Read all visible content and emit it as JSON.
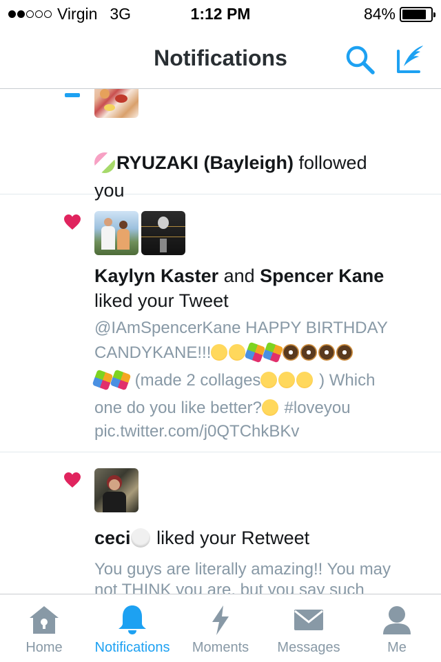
{
  "status_bar": {
    "carrier": "Virgin",
    "network": "3G",
    "time": "1:12 PM",
    "battery": "84%",
    "battery_level": 0.84,
    "signal_bars_filled": 2,
    "signal_bars_total": 5
  },
  "header": {
    "title": "Notifications",
    "search_icon": "search-icon",
    "compose_icon": "compose-tweet-icon"
  },
  "colors": {
    "accent": "#1da1f2",
    "like": "#e0245e",
    "muted": "#8899a6",
    "text": "#14171a"
  },
  "notifications": [
    {
      "type": "follow",
      "icon": "person-icon",
      "name_prefix_emoji": "dango-emoji",
      "name": "RYUZAKI (Bayleigh)",
      "action_line1": " followed",
      "action_line2": "you"
    },
    {
      "type": "like",
      "icon": "heart-icon",
      "user1": "Kaylyn Kaster",
      "joiner": " and ",
      "user2": "Spencer Kane",
      "action": "liked your Tweet",
      "tweet_line1": "@IAmSpencerKane HAPPY BIRTHDAY",
      "tweet_line2": "CANDYKANE!!!",
      "tweet_line3_text": " (made 2 collages",
      "tweet_line3_tail": " Which",
      "tweet_line4": "one do you like better?",
      "tweet_line4_tail": " #loveyou",
      "tweet_line5": "pic.twitter.com/j0QTChkBKv"
    },
    {
      "type": "like",
      "icon": "heart-icon",
      "user": "ceci",
      "user_emoji": "skull-emoji",
      "action": " liked your Retweet",
      "tweet_line1": "You guys are literally amazing!! You may",
      "tweet_line2": "not THINK you are, but you say such"
    }
  ],
  "tabs": [
    {
      "label": "Home",
      "icon": "home-icon",
      "active": false
    },
    {
      "label": "Notifications",
      "icon": "bell-icon",
      "active": true
    },
    {
      "label": "Moments",
      "icon": "lightning-icon",
      "active": false
    },
    {
      "label": "Messages",
      "icon": "envelope-icon",
      "active": false
    },
    {
      "label": "Me",
      "icon": "person-icon",
      "active": false
    }
  ]
}
